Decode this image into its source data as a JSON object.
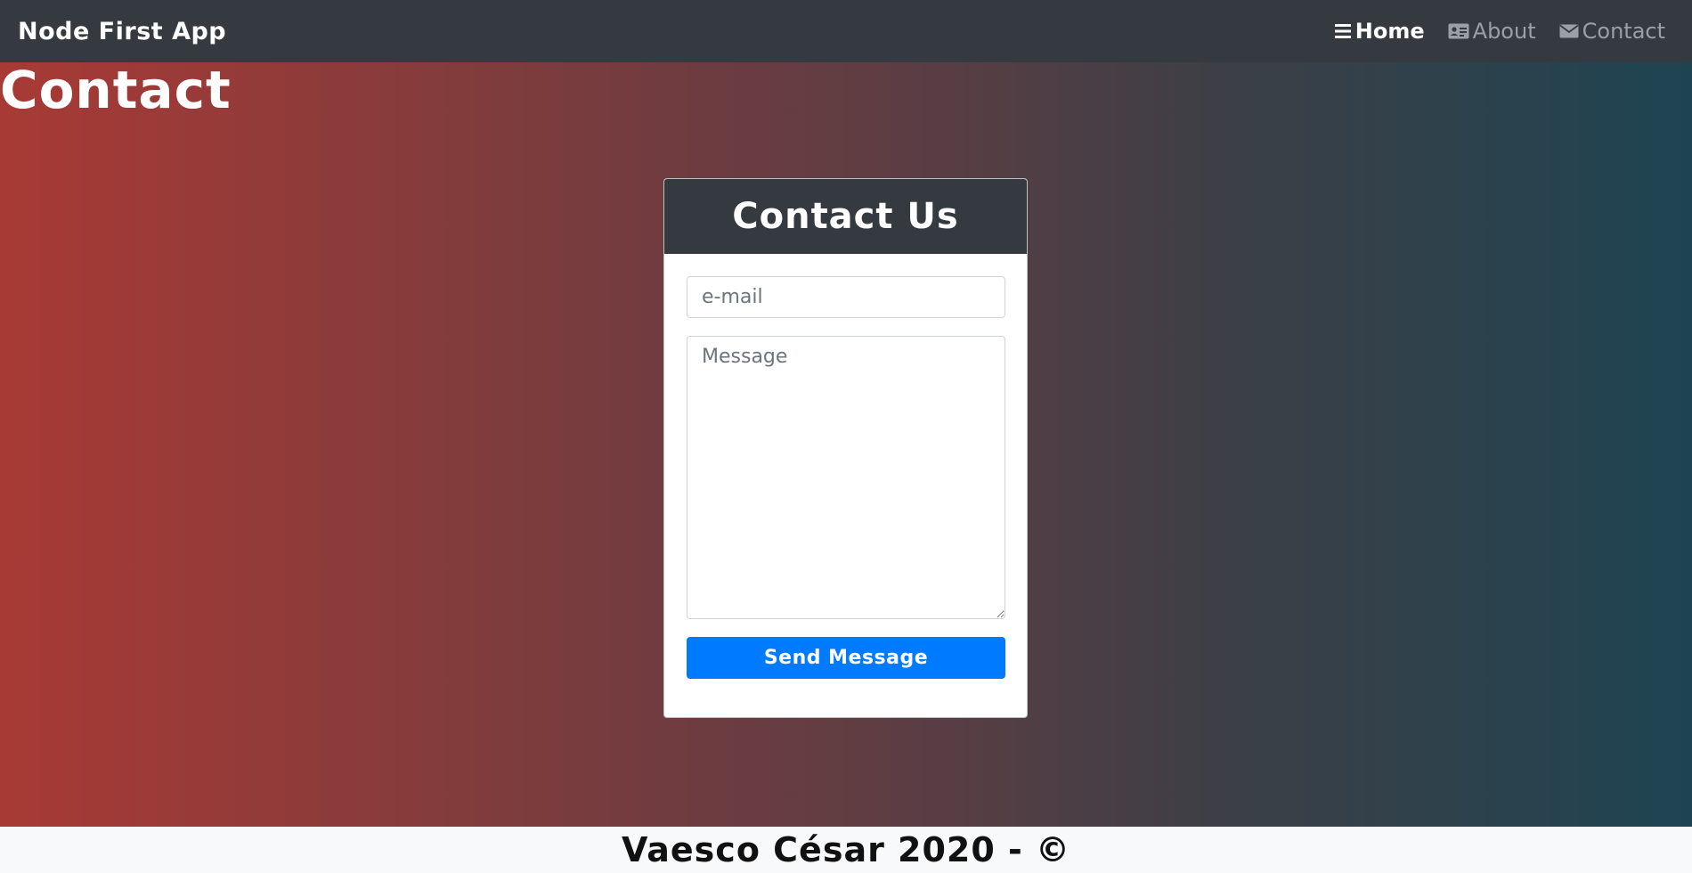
{
  "navbar": {
    "brand": "Node First App",
    "links": [
      {
        "label": "Home",
        "icon": "bars-icon",
        "active": true
      },
      {
        "label": "About",
        "icon": "id-card-icon",
        "active": false
      },
      {
        "label": "Contact",
        "icon": "envelope-icon",
        "active": false
      }
    ]
  },
  "page": {
    "title": "Contact"
  },
  "contact_form": {
    "title": "Contact Us",
    "email_placeholder": "e-mail",
    "message_placeholder": "Message",
    "submit_label": "Send Message"
  },
  "footer": {
    "text": "Vaesco César 2020 - ©"
  },
  "colors": {
    "navbar_bg": "#343a40",
    "primary_button": "#007bff",
    "gradient_start": "#a83a35",
    "gradient_end": "#1e4452",
    "footer_bg": "#f8f9fa"
  }
}
